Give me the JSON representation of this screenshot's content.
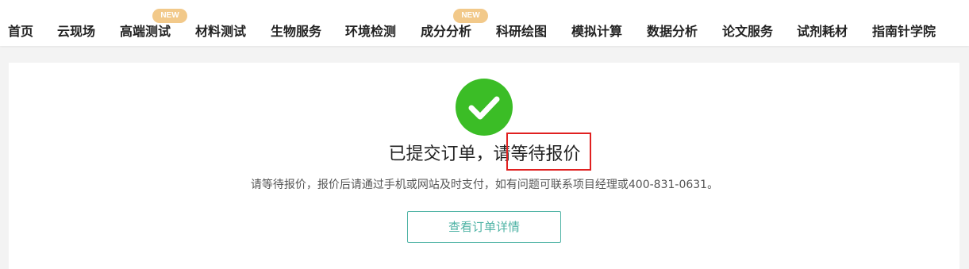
{
  "nav": {
    "items": [
      {
        "label": "首页"
      },
      {
        "label": "云现场"
      },
      {
        "label": "高端测试",
        "badge": "NEW"
      },
      {
        "label": "材料测试"
      },
      {
        "label": "生物服务"
      },
      {
        "label": "环境检测"
      },
      {
        "label": "成分分析",
        "badge": "NEW"
      },
      {
        "label": "科研绘图"
      },
      {
        "label": "模拟计算"
      },
      {
        "label": "数据分析"
      },
      {
        "label": "论文服务"
      },
      {
        "label": "试剂耗材"
      },
      {
        "label": "指南针学院"
      }
    ]
  },
  "result": {
    "icon": "check-circle-icon",
    "title": "已提交订单，请等待报价",
    "message": "请等待报价，报价后请通过手机或网站及时支付，如有问题可联系项目经理或400-831-0631。",
    "button_label": "查看订单详情"
  },
  "colors": {
    "success": "#3bbd26",
    "accent": "#4fb3a5",
    "badge": "#f2c98a",
    "highlight": "#e02020"
  }
}
